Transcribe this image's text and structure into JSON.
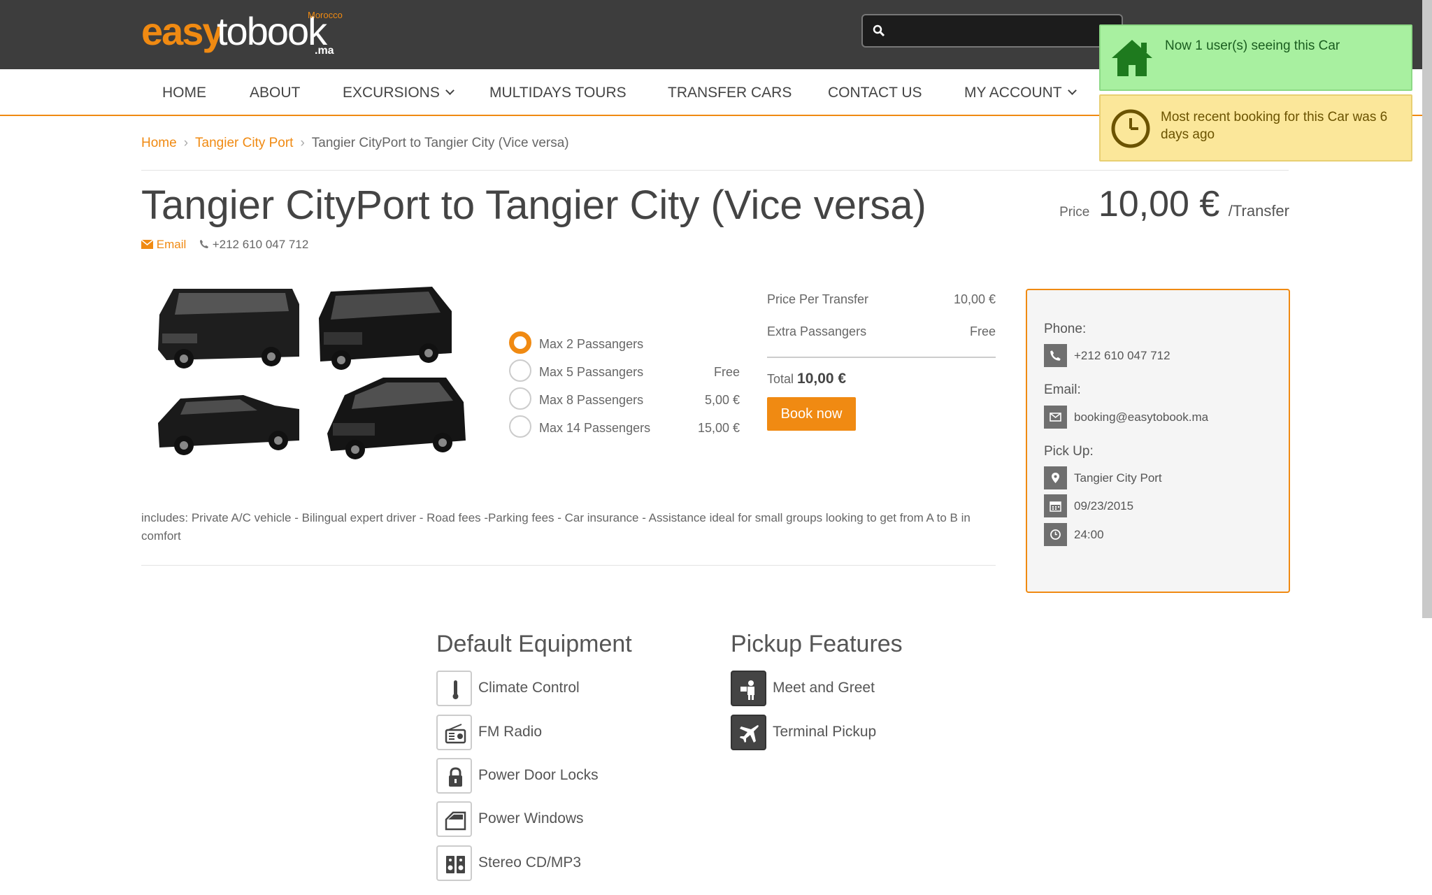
{
  "brand": {
    "part1": "easy",
    "part2": "tobook",
    "country": "Morocco",
    "tld": ".ma"
  },
  "search": {
    "placeholder": ""
  },
  "nav": {
    "home": "HOME",
    "about": "ABOUT",
    "excursions": "EXCURSIONS",
    "multidays": "MULTIDAYS TOURS",
    "transfer": "TRANSFER CARS",
    "contact": "CONTACT US",
    "account": "MY ACCOUNT"
  },
  "notifications": {
    "viewers": "Now 1 user(s) seeing this Car",
    "recent": "Most recent booking for this Car was 6 days ago"
  },
  "breadcrumb": {
    "home": "Home",
    "city_port": "Tangier City Port",
    "current": "Tangier CityPort to Tangier City (Vice versa)"
  },
  "product": {
    "title": "Tangier CityPort to Tangier City (Vice versa)",
    "email_label": "Email",
    "phone": "+212 610 047 712",
    "price_label": "Price",
    "price": "10,00 €",
    "price_unit": "/Transfer"
  },
  "passenger_options": [
    {
      "label": "Max 2 Passangers",
      "price": "",
      "selected": true
    },
    {
      "label": "Max 5 Passangers",
      "price": "Free",
      "selected": false
    },
    {
      "label": "Max 8 Passengers",
      "price": "5,00 €",
      "selected": false
    },
    {
      "label": "Max 14 Passengers",
      "price": "15,00 €",
      "selected": false
    }
  ],
  "summary": {
    "per_transfer_label": "Price Per Transfer",
    "per_transfer_value": "10,00 €",
    "extra_label": "Extra Passangers",
    "extra_value": "Free",
    "total_label": "Total",
    "total_value": "10,00 €",
    "book_button": "Book now"
  },
  "includes": "includes: Private A/C vehicle - Bilingual expert driver - Road fees -Parking fees - Car insurance - Assistance ideal for small groups looking to get from A to B in comfort",
  "sidebar": {
    "phone_heading": "Phone:",
    "phone": "+212 610 047 712",
    "email_heading": "Email:",
    "email": "booking@easytobook.ma",
    "pickup_heading": "Pick Up:",
    "pickup_location": "Tangier City Port",
    "pickup_date": "09/23/2015",
    "pickup_time": "24:00"
  },
  "equipment": {
    "heading": "Default Equipment",
    "items": [
      "Climate Control",
      "FM Radio",
      "Power Door Locks",
      "Power Windows",
      "Stereo CD/MP3"
    ]
  },
  "pickup_features": {
    "heading": "Pickup Features",
    "items": [
      "Meet and Greet",
      "Terminal Pickup"
    ]
  },
  "colors": {
    "accent": "#f08a12",
    "header_bg": "#3d3d3d",
    "notice_green": "#a8f0a0",
    "notice_yellow": "#fbe79a"
  }
}
